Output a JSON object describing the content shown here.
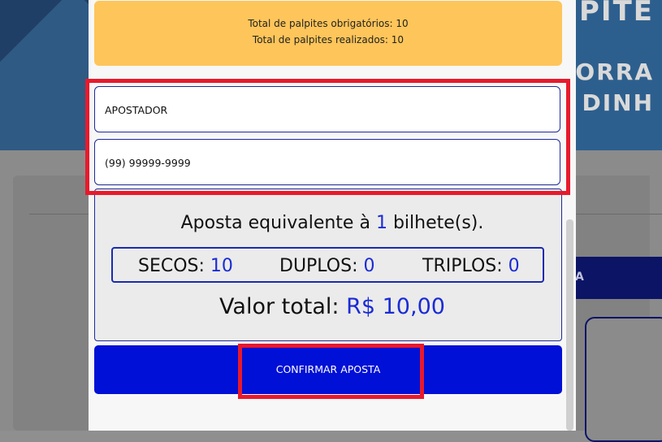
{
  "background": {
    "banner_text_1": "PITE",
    "banner_text_2": "ORRA",
    "banner_text_3": "DINH",
    "tab_text": "A"
  },
  "info": {
    "required_label": "Total de palpites obrigatórios: 10",
    "made_label": "Total de palpites realizados: 10"
  },
  "form": {
    "name_value": "APOSTADOR",
    "phone_value": "(99) 99999-9999"
  },
  "summary": {
    "equiv_prefix": "Aposta equivalente à",
    "equiv_count": "1",
    "equiv_suffix": "bilhete(s).",
    "secos_label": "SECOS:",
    "secos_value": "10",
    "duplos_label": "DUPLOS:",
    "duplos_value": "0",
    "triplos_label": "TRIPLOS:",
    "triplos_value": "0",
    "total_label": "Valor total:",
    "total_value": "R$ 10,00"
  },
  "actions": {
    "confirm_label": "CONFIRMAR APOSTA"
  },
  "colors": {
    "accent": "#0010d6",
    "warning_bg": "#fec55a",
    "highlight": "#e8192c"
  }
}
